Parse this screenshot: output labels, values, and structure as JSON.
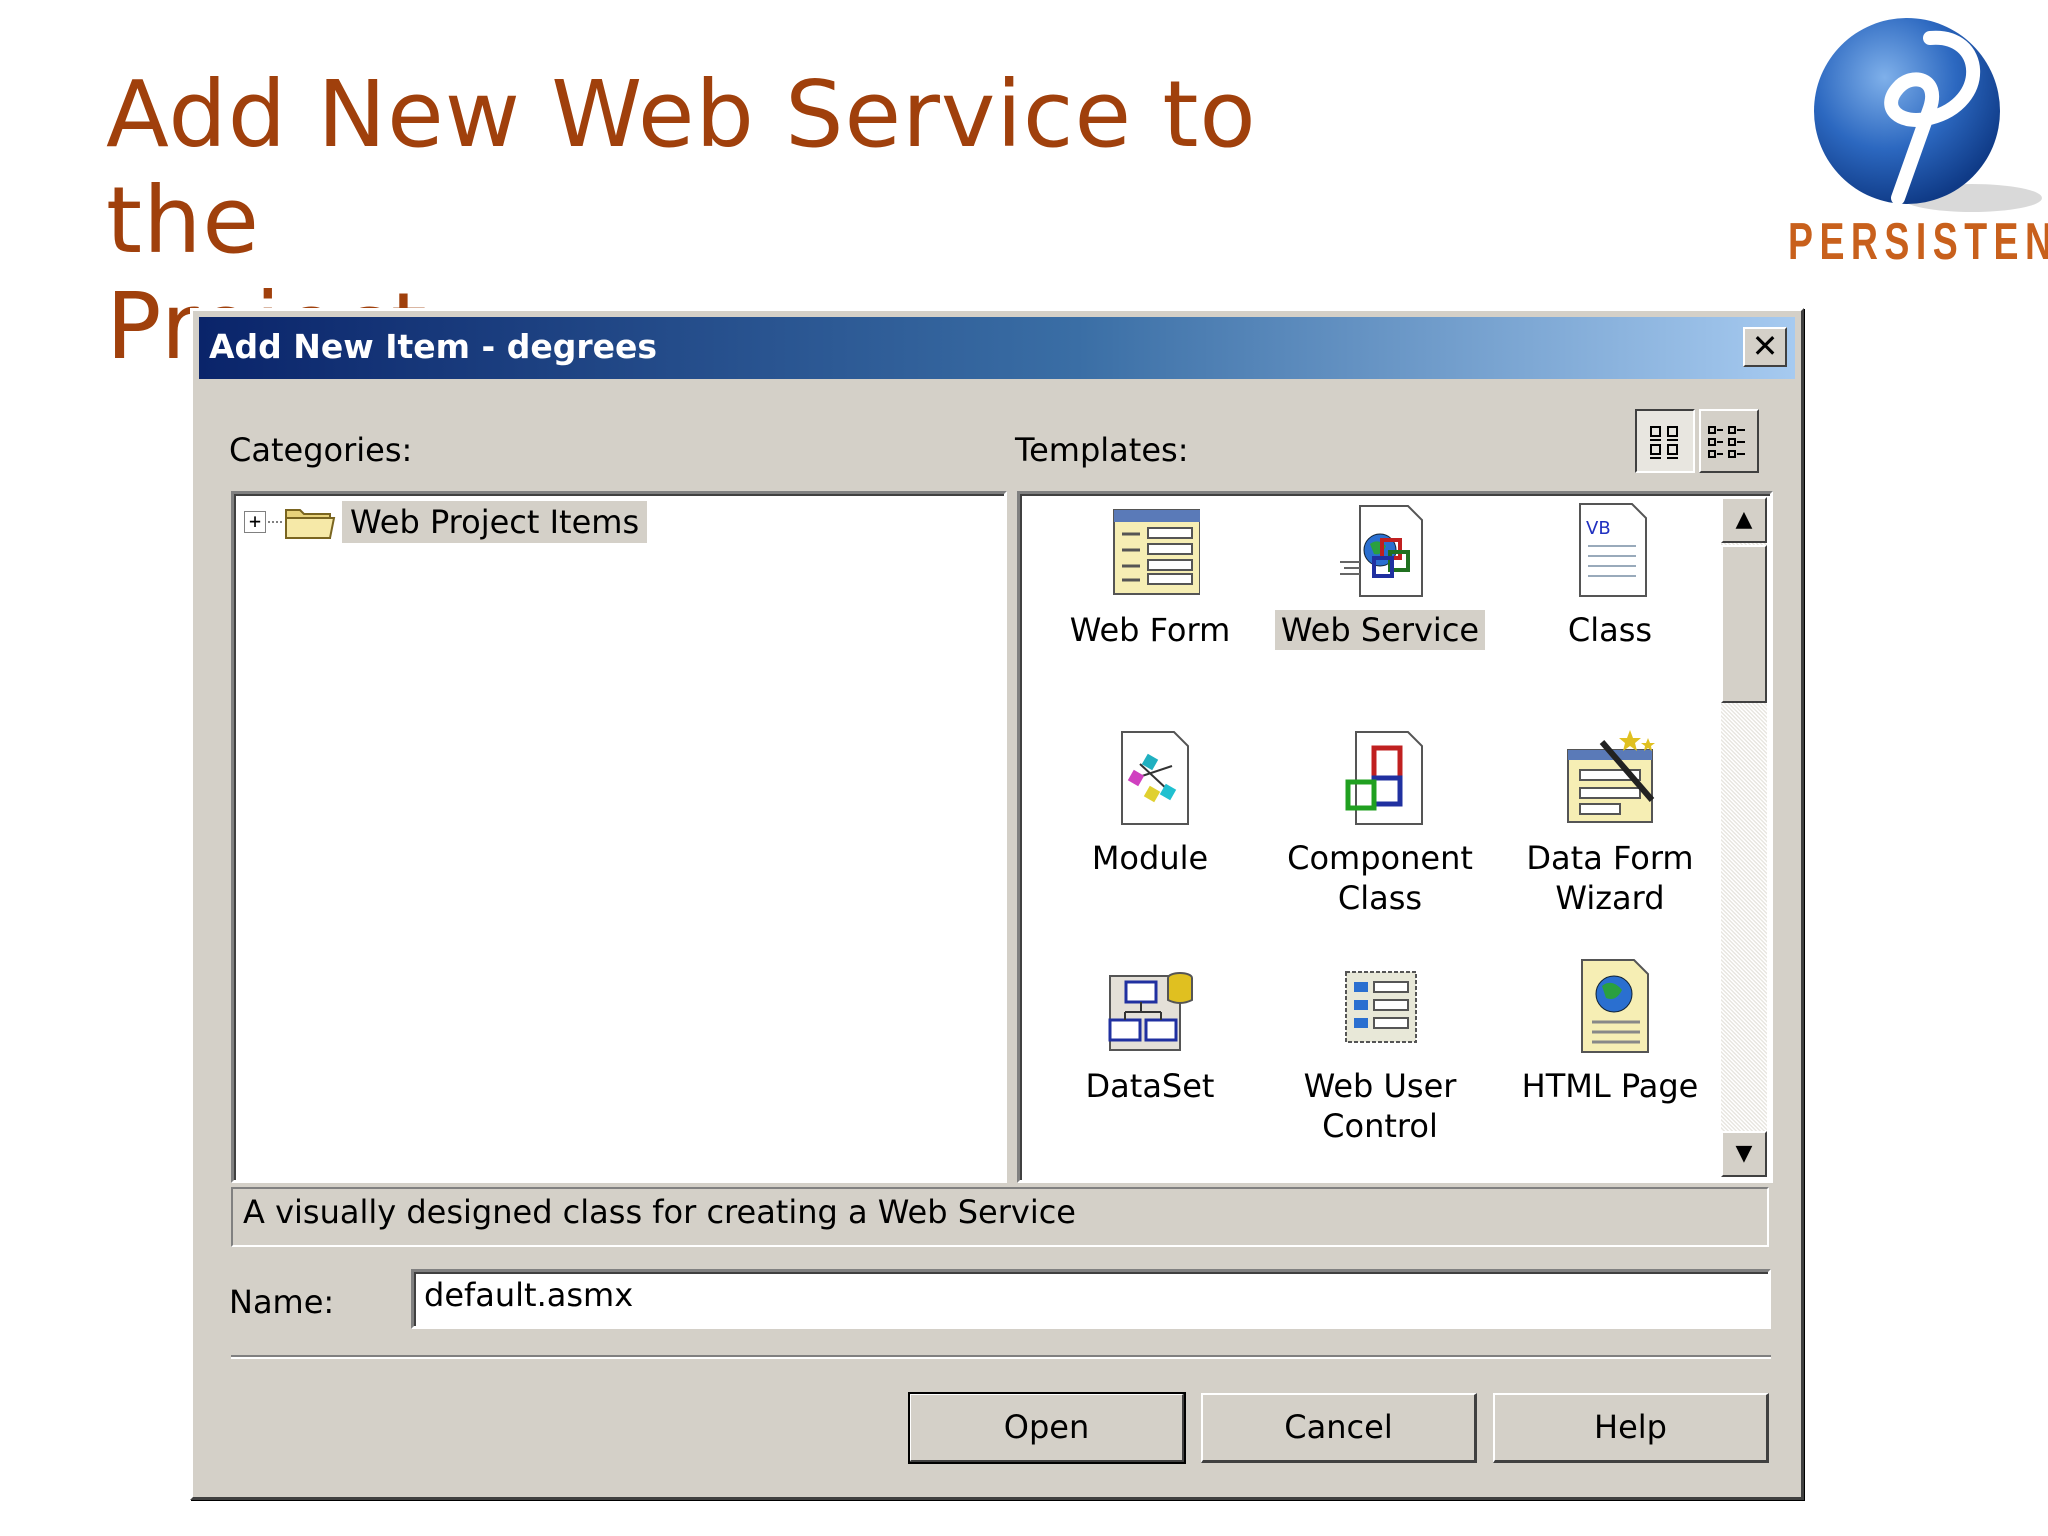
{
  "slide": {
    "title_line1": "Add New Web Service to the",
    "title_line2": "Project",
    "logo_text": "PERSISTENT",
    "title_color": "#a0400c"
  },
  "dialog": {
    "title": "Add New Item - degrees",
    "close_label": "✕",
    "categories_label": "Categories:",
    "templates_label": "Templates:",
    "view_large_icons": "large-icons-view-icon",
    "view_small_icons": "list-view-icon",
    "category_tree": [
      {
        "label": "Web Project Items",
        "expander": "+",
        "icon": "folder-icon"
      }
    ],
    "templates": [
      {
        "label": "Web Form",
        "icon": "web-form-icon"
      },
      {
        "label": "Web Service",
        "icon": "web-service-icon",
        "selected": true
      },
      {
        "label": "Class",
        "icon": "vb-class-icon"
      },
      {
        "label": "Module",
        "icon": "module-icon"
      },
      {
        "label": "Component Class",
        "icon": "component-class-icon"
      },
      {
        "label": "Data Form Wizard",
        "icon": "data-form-wizard-icon"
      },
      {
        "label": "DataSet",
        "icon": "dataset-icon"
      },
      {
        "label": "Web User Control",
        "icon": "web-user-control-icon"
      },
      {
        "label": "HTML Page",
        "icon": "html-page-icon"
      }
    ],
    "description": "A visually designed class for creating a Web Service",
    "name_label": "Name:",
    "name_value": "default.asmx",
    "buttons": {
      "open": "Open",
      "cancel": "Cancel",
      "help": "Help"
    },
    "scroll_up": "▲",
    "scroll_down": "▼"
  }
}
